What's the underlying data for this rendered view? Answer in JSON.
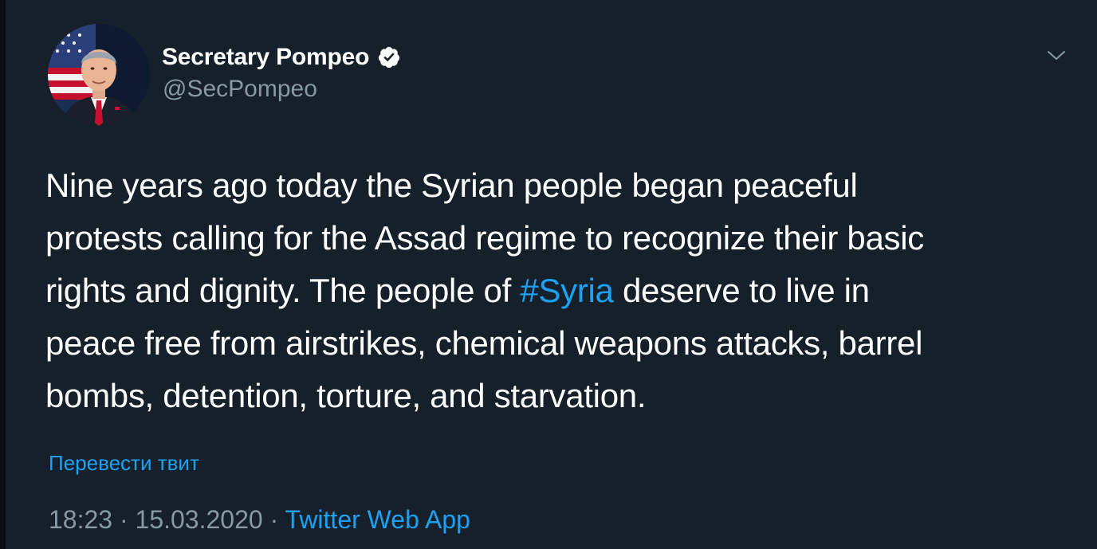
{
  "author": {
    "display_name": "Secretary Pompeo",
    "handle": "@SecPompeo",
    "verified": true
  },
  "tweet": {
    "lines": [
      {
        "text": "Nine years ago today the Syrian people began peaceful"
      },
      {
        "text": "protests calling for the Assad regime to recognize their basic"
      },
      {
        "before": "rights and dignity. The people of ",
        "hashtag": "#Syria",
        "after": " deserve to live in"
      },
      {
        "text": "peace free from airstrikes, chemical weapons attacks, barrel"
      },
      {
        "text": "bombs, detention, torture, and starvation."
      }
    ]
  },
  "translate_link": "Перевести твит",
  "meta": {
    "time": "18:23",
    "separator": "·",
    "date": "15.03.2020",
    "app": "Twitter Web App"
  },
  "icons": {
    "verified": "verified-badge-icon",
    "caret": "chevron-down-icon"
  },
  "colors": {
    "background": "#15202b",
    "accent": "#1da1f2",
    "secondary_text": "#8899a6",
    "primary_text": "#ffffff"
  }
}
